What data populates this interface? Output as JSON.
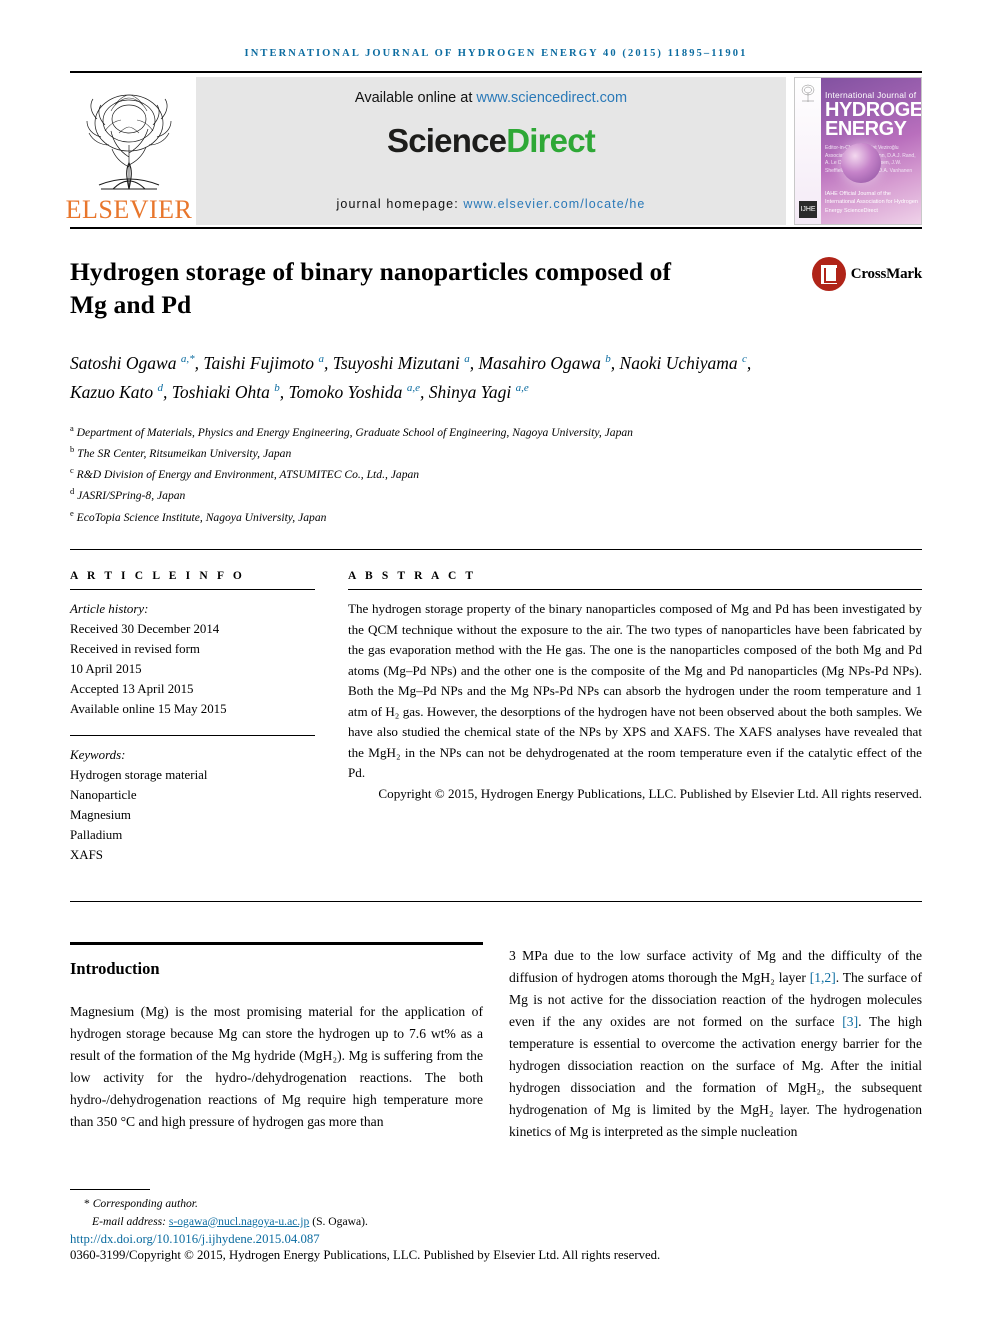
{
  "running_head": "International Journal of Hydrogen Energy 40 (2015) 11895–11901",
  "masthead": {
    "publisher_name": "ELSEVIER",
    "publisher_logo_icon": "elsevier-tree-icon",
    "available_text": "Available online at",
    "available_url": "www.sciencedirect.com",
    "sciencedirect_science": "Science",
    "sciencedirect_direct": "Direct",
    "homepage_label": "journal homepage:",
    "homepage_url": "www.elsevier.com/locate/he",
    "cover": {
      "line_small": "International Journal of",
      "line_big_1": "HYDROGEN",
      "line_big_2": "ENERGY",
      "editors_text": "Editor-in-Chief: T. Nejat Veziroğlu   Associate Editors: S. Dunn, D.A.J. Rand, A. Le Duigou, A.S. Pedersen, J.W. Sheffield, I.E. Trent and D.A. Vanhanen",
      "bottom_text": "IAHE Official Journal of the International Association for Hydrogen Energy   ScienceDirect",
      "ifc_badge": "IJHE"
    }
  },
  "article": {
    "title": "Hydrogen storage of binary nanoparticles composed of Mg and Pd",
    "crossmark_label": "CrossMark",
    "authors": [
      {
        "name": "Satoshi Ogawa",
        "marks": "a,*"
      },
      {
        "name": "Taishi Fujimoto",
        "marks": "a"
      },
      {
        "name": "Tsuyoshi Mizutani",
        "marks": "a"
      },
      {
        "name": "Masahiro Ogawa",
        "marks": "b"
      },
      {
        "name": "Naoki Uchiyama",
        "marks": "c"
      },
      {
        "name": "Kazuo Kato",
        "marks": "d"
      },
      {
        "name": "Toshiaki Ohta",
        "marks": "b"
      },
      {
        "name": "Tomoko Yoshida",
        "marks": "a,e"
      },
      {
        "name": "Shinya Yagi",
        "marks": "a,e"
      }
    ],
    "affiliations": [
      {
        "mark": "a",
        "text": "Department of Materials, Physics and Energy Engineering, Graduate School of Engineering, Nagoya University, Japan"
      },
      {
        "mark": "b",
        "text": "The SR Center, Ritsumeikan University, Japan"
      },
      {
        "mark": "c",
        "text": "R&D Division of Energy and Environment, ATSUMITEC Co., Ltd., Japan"
      },
      {
        "mark": "d",
        "text": "JASRI/SPring-8, Japan"
      },
      {
        "mark": "e",
        "text": "EcoTopia Science Institute, Nagoya University, Japan"
      }
    ]
  },
  "article_info": {
    "section_label": "A R T I C L E   I N F O",
    "history_heading": "Article history:",
    "history_lines": [
      "Received 30 December 2014",
      "Received in revised form",
      "10 April 2015",
      "Accepted 13 April 2015",
      "Available online 15 May 2015"
    ],
    "keywords_heading": "Keywords:",
    "keywords": [
      "Hydrogen storage material",
      "Nanoparticle",
      "Magnesium",
      "Palladium",
      "XAFS"
    ]
  },
  "abstract": {
    "section_label": "A B S T R A C T",
    "body": "The hydrogen storage property of the binary nanoparticles composed of Mg and Pd has been investigated by the QCM technique without the exposure to the air. The two types of nanoparticles have been fabricated by the gas evaporation method with the He gas. The one is the nanoparticles composed of the both Mg and Pd atoms (Mg–Pd NPs) and the other one is the composite of the Mg and Pd nanoparticles (Mg NPs-Pd NPs). Both the Mg–Pd NPs and the Mg NPs-Pd NPs can absorb the hydrogen under the room temperature and 1 atm of H₂ gas. However, the desorptions of the hydrogen have not been observed about the both samples. We have also studied the chemical state of the NPs by XPS and XAFS. The XAFS analyses have revealed that the MgH₂ in the NPs can not be dehydrogenated at the room temperature even if the catalytic effect of the Pd.",
    "copyright": "Copyright © 2015, Hydrogen Energy Publications, LLC. Published by Elsevier Ltd. All rights reserved."
  },
  "introduction": {
    "heading": "Introduction",
    "left_column": "Magnesium (Mg) is the most promising material for the application of hydrogen storage because Mg can store the hydrogen up to 7.6 wt% as a result of the formation of the Mg hydride (MgH₂). Mg is suffering from the low activity for the hydro-/dehydrogenation reactions. The both hydro-/dehydrogenation reactions of Mg require high temperature more than 350 °C and high pressure of hydrogen gas more than",
    "right_column_part1": "3 MPa due to the low surface activity of Mg and the difficulty of the diffusion of hydrogen atoms thorough the MgH₂ layer ",
    "right_citation1": "[1,2]",
    "right_column_part2": ". The surface of Mg is not active for the dissociation reaction of the hydrogen molecules even if the any oxides are not formed on the surface ",
    "right_citation2": "[3]",
    "right_column_part3": ". The high temperature is essential to overcome the activation energy barrier for the hydrogen dissociation reaction on the surface of Mg. After the initial hydrogen dissociation and the formation of MgH₂, the subsequent hydrogenation of Mg is limited by the MgH₂ layer. The hydrogenation kinetics of Mg is interpreted as the simple nucleation"
  },
  "footer": {
    "corresponding_marker": "*",
    "corresponding_label": "Corresponding author.",
    "email_label": "E-mail address:",
    "email_address": "s-ogawa@nucl.nagoya-u.ac.jp",
    "email_owner": "(S. Ogawa).",
    "doi_url": "http://dx.doi.org/10.1016/j.ijhydene.2015.04.087",
    "issn_copyright": "0360-3199/Copyright © 2015, Hydrogen Energy Publications, LLC. Published by Elsevier Ltd. All rights reserved."
  },
  "colors": {
    "journal_blue": "#0c6ca0",
    "link_blue": "#2a79b8",
    "sciencedirect_green": "#2ea836",
    "elsevier_orange": "#E8762C",
    "crossmark_red": "#b02418"
  }
}
